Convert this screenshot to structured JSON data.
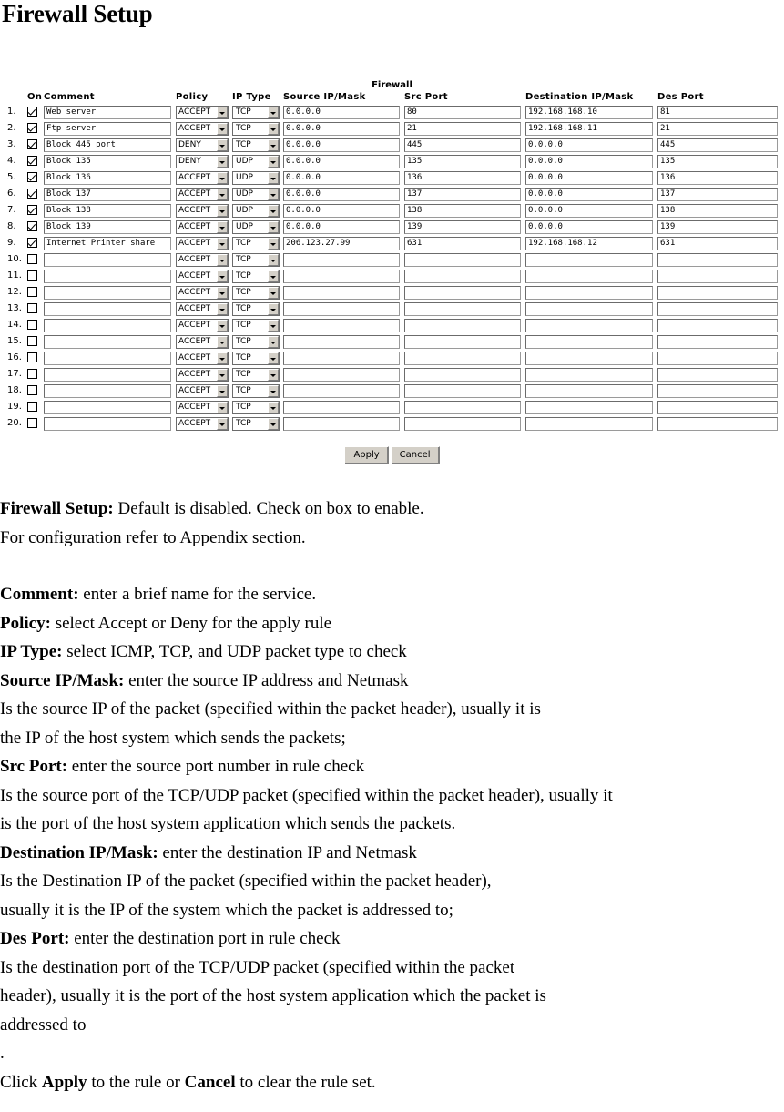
{
  "page": {
    "title": "Firewall Setup"
  },
  "firewall_form": {
    "caption": "Firewall",
    "headers": {
      "num": "",
      "on": "On",
      "comment": "Comment",
      "policy": "Policy",
      "ip_type": "IP Type",
      "source_ip": "Source IP/Mask",
      "src_port": "Src Port",
      "dest_ip": "Destination IP/Mask",
      "des_port": "Des Port"
    },
    "policy_options": [
      "ACCEPT",
      "DENY"
    ],
    "ip_type_options": [
      "ICMP",
      "TCP",
      "UDP"
    ],
    "rows": [
      {
        "num": "1.",
        "on": true,
        "comment": "Web server",
        "policy": "ACCEPT",
        "ip_type": "TCP",
        "source_ip": "0.0.0.0",
        "src_port": "80",
        "dest_ip": "192.168.168.10",
        "des_port": "81"
      },
      {
        "num": "2.",
        "on": true,
        "comment": "Ftp server",
        "policy": "ACCEPT",
        "ip_type": "TCP",
        "source_ip": "0.0.0.0",
        "src_port": "21",
        "dest_ip": "192.168.168.11",
        "des_port": "21"
      },
      {
        "num": "3.",
        "on": true,
        "comment": "Block 445 port",
        "policy": "DENY",
        "ip_type": "TCP",
        "source_ip": "0.0.0.0",
        "src_port": "445",
        "dest_ip": "0.0.0.0",
        "des_port": "445"
      },
      {
        "num": "4.",
        "on": true,
        "comment": "Block 135",
        "policy": "DENY",
        "ip_type": "UDP",
        "source_ip": "0.0.0.0",
        "src_port": "135",
        "dest_ip": "0.0.0.0",
        "des_port": "135"
      },
      {
        "num": "5.",
        "on": true,
        "comment": "Block 136",
        "policy": "ACCEPT",
        "ip_type": "UDP",
        "source_ip": "0.0.0.0",
        "src_port": "136",
        "dest_ip": "0.0.0.0",
        "des_port": "136"
      },
      {
        "num": "6.",
        "on": true,
        "comment": "Block 137",
        "policy": "ACCEPT",
        "ip_type": "UDP",
        "source_ip": "0.0.0.0",
        "src_port": "137",
        "dest_ip": "0.0.0.0",
        "des_port": "137"
      },
      {
        "num": "7.",
        "on": true,
        "comment": "Block 138",
        "policy": "ACCEPT",
        "ip_type": "UDP",
        "source_ip": "0.0.0.0",
        "src_port": "138",
        "dest_ip": "0.0.0.0",
        "des_port": "138"
      },
      {
        "num": "8.",
        "on": true,
        "comment": "Block 139",
        "policy": "ACCEPT",
        "ip_type": "UDP",
        "source_ip": "0.0.0.0",
        "src_port": "139",
        "dest_ip": "0.0.0.0",
        "des_port": "139"
      },
      {
        "num": "9.",
        "on": true,
        "comment": "Internet Printer share",
        "policy": "ACCEPT",
        "ip_type": "TCP",
        "source_ip": "206.123.27.99",
        "src_port": "631",
        "dest_ip": "192.168.168.12",
        "des_port": "631"
      },
      {
        "num": "10.",
        "on": false,
        "comment": "",
        "policy": "ACCEPT",
        "ip_type": "TCP",
        "source_ip": "",
        "src_port": "",
        "dest_ip": "",
        "des_port": ""
      },
      {
        "num": "11.",
        "on": false,
        "comment": "",
        "policy": "ACCEPT",
        "ip_type": "TCP",
        "source_ip": "",
        "src_port": "",
        "dest_ip": "",
        "des_port": ""
      },
      {
        "num": "12.",
        "on": false,
        "comment": "",
        "policy": "ACCEPT",
        "ip_type": "TCP",
        "source_ip": "",
        "src_port": "",
        "dest_ip": "",
        "des_port": ""
      },
      {
        "num": "13.",
        "on": false,
        "comment": "",
        "policy": "ACCEPT",
        "ip_type": "TCP",
        "source_ip": "",
        "src_port": "",
        "dest_ip": "",
        "des_port": ""
      },
      {
        "num": "14.",
        "on": false,
        "comment": "",
        "policy": "ACCEPT",
        "ip_type": "TCP",
        "source_ip": "",
        "src_port": "",
        "dest_ip": "",
        "des_port": ""
      },
      {
        "num": "15.",
        "on": false,
        "comment": "",
        "policy": "ACCEPT",
        "ip_type": "TCP",
        "source_ip": "",
        "src_port": "",
        "dest_ip": "",
        "des_port": ""
      },
      {
        "num": "16.",
        "on": false,
        "comment": "",
        "policy": "ACCEPT",
        "ip_type": "TCP",
        "source_ip": "",
        "src_port": "",
        "dest_ip": "",
        "des_port": ""
      },
      {
        "num": "17.",
        "on": false,
        "comment": "",
        "policy": "ACCEPT",
        "ip_type": "TCP",
        "source_ip": "",
        "src_port": "",
        "dest_ip": "",
        "des_port": ""
      },
      {
        "num": "18.",
        "on": false,
        "comment": "",
        "policy": "ACCEPT",
        "ip_type": "TCP",
        "source_ip": "",
        "src_port": "",
        "dest_ip": "",
        "des_port": ""
      },
      {
        "num": "19.",
        "on": false,
        "comment": "",
        "policy": "ACCEPT",
        "ip_type": "TCP",
        "source_ip": "",
        "src_port": "",
        "dest_ip": "",
        "des_port": ""
      },
      {
        "num": "20.",
        "on": false,
        "comment": "",
        "policy": "ACCEPT",
        "ip_type": "TCP",
        "source_ip": "",
        "src_port": "",
        "dest_ip": "",
        "des_port": ""
      }
    ],
    "apply_label": "Apply",
    "cancel_label": "Cancel"
  },
  "description": {
    "firewall_setup_label": "Firewall Setup:",
    "firewall_setup_text": " Default is disabled. Check on box to enable.",
    "firewall_setup_line2": "For configuration refer to Appendix section.",
    "comment_label": "Comment:",
    "comment_text": " enter a brief name for the service.",
    "policy_label": "Policy:",
    "policy_text": " select Accept or Deny for the apply rule",
    "ip_type_label": "IP Type:",
    "ip_type_text": " select ICMP, TCP, and UDP packet type to check",
    "source_label": "Source IP/Mask:",
    "source_text": " enter the source IP address and Netmask",
    "source_note1": "Is the source IP of the packet (specified within the packet header), usually it is",
    "source_note2": "the IP of the host system which sends the packets;",
    "srcport_label": "Src Port:",
    "srcport_text": " enter the source port number in rule check",
    "srcport_note1": "Is the source port of the TCP/UDP packet (specified within the packet header), usually it",
    "srcport_note2": "is the port of the host system application which sends the packets.",
    "dest_label": "Destination IP/Mask:",
    "dest_text": " enter the destination IP and Netmask",
    "dest_note1": "Is the Destination IP of the packet (specified within the packet header),",
    "dest_note2": "usually it is the IP of the system which the packet is addressed to;",
    "desport_label": "Des Port:",
    "desport_text": " enter the destination port in rule check",
    "desport_note1": "Is the destination port of the TCP/UDP packet (specified within the packet",
    "desport_note2": "header), usually it is the port of the host system application which the packet is",
    "desport_note3": "addressed to",
    "lone_period": ".",
    "click_pre": "Click ",
    "click_apply": "Apply",
    "click_mid": " to the rule or ",
    "click_cancel": "Cancel",
    "click_post": " to clear the rule set."
  }
}
